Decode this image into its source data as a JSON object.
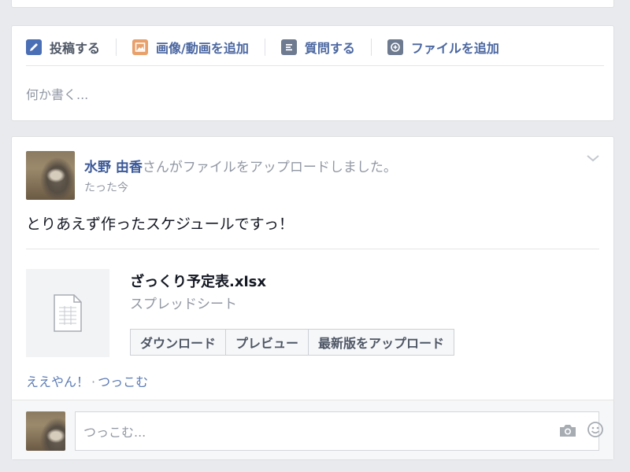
{
  "composer": {
    "tabs": [
      {
        "label": "投稿する",
        "icon": "pencil-icon"
      },
      {
        "label": "画像/動画を追加",
        "icon": "photo-icon"
      },
      {
        "label": "質問する",
        "icon": "question-icon"
      },
      {
        "label": "ファイルを追加",
        "icon": "add-file-icon"
      }
    ],
    "placeholder": "何か書く..."
  },
  "post": {
    "author": "水野 由香",
    "action": "さんがファイルをアップロードしました。",
    "time": "たった今",
    "message": "とりあえず作ったスケジュールですっ！",
    "file": {
      "name": "ざっくり予定表.xlsx",
      "type": "スプレッドシート",
      "buttons": {
        "download": "ダウンロード",
        "preview": "プレビュー",
        "upload_latest": "最新版をアップロード"
      }
    },
    "actions": {
      "like": "ええやん！",
      "separator": "·",
      "comment": "つっこむ"
    },
    "comment_placeholder": "つっこむ..."
  },
  "colors": {
    "link": "#3b5998",
    "background": "#e9eaed",
    "photo_icon": "#e9a06a"
  }
}
